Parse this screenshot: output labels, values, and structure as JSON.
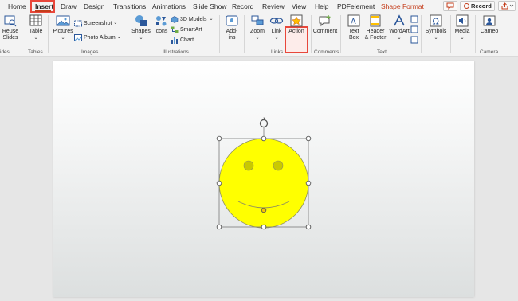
{
  "tabs": [
    "Home",
    "Insert",
    "Draw",
    "Design",
    "Transitions",
    "Animations",
    "Slide Show",
    "Record",
    "Review",
    "View",
    "Help",
    "PDFelement",
    "Shape Format"
  ],
  "active_tab": "Insert",
  "top_buttons": {
    "comment_icon": "comment-icon",
    "record_label": "Record",
    "share_icon": "share-icon"
  },
  "ribbon": {
    "reuse_slides": "Reuse\nSlides",
    "table": "Table",
    "pictures": "Pictures",
    "screenshot": "Screenshot",
    "photo_album": "Photo Album",
    "shapes": "Shapes",
    "icons": "Icons",
    "models_3d": "3D Models",
    "smartart": "SmartArt",
    "chart": "Chart",
    "addins": "Add-\nins",
    "zoom": "Zoom",
    "link": "Link",
    "action": "Action",
    "comment": "Comment",
    "text_box": "Text\nBox",
    "header_footer": "Header\n& Footer",
    "wordart": "WordArt",
    "symbols": "Symbols",
    "media": "Media",
    "cameo": "Cameo"
  },
  "groups": [
    "ides",
    "Tables",
    "Images",
    "Illustrations",
    "Links",
    "Comments",
    "Text",
    "Camera"
  ],
  "colors": {
    "accent": "#c43e1c",
    "highlight": "#e8473b",
    "smiley_fill": "#ffff00",
    "eye_fill": "#c9c900"
  }
}
